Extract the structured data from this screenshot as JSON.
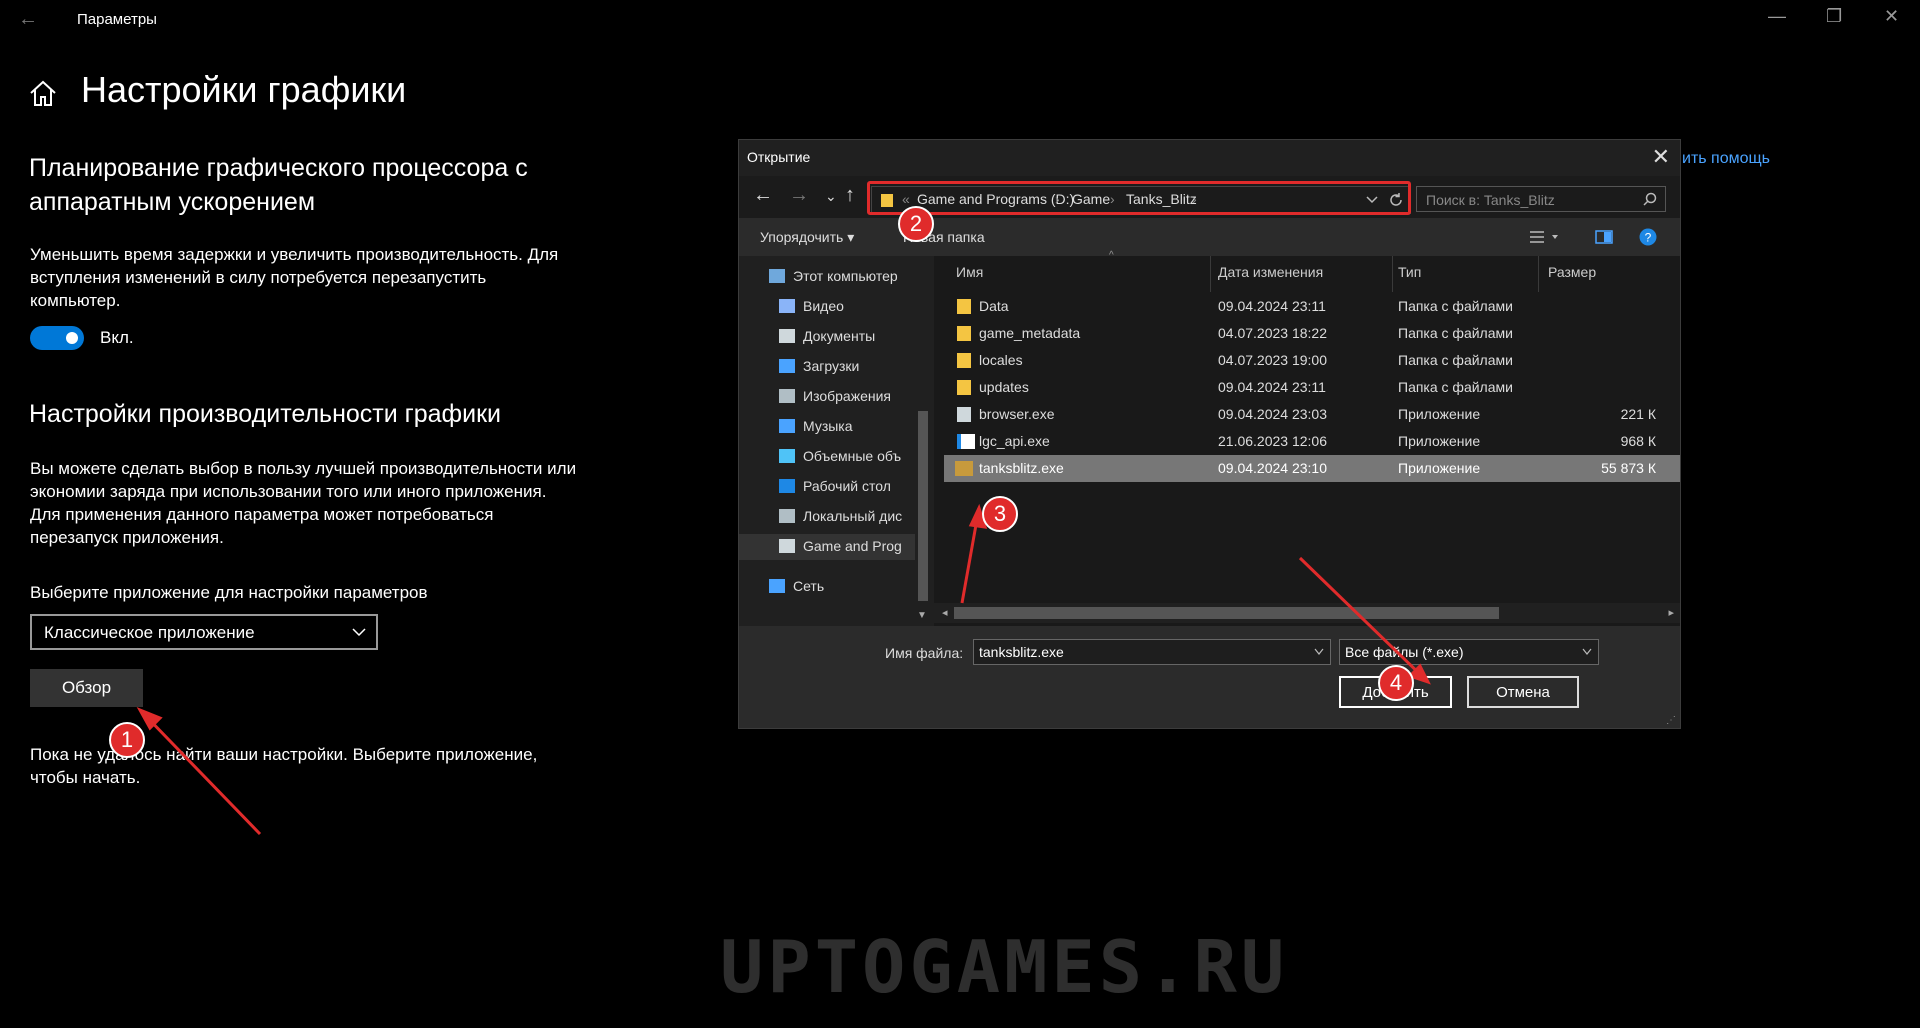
{
  "window": {
    "back_glyph": "←",
    "app_title": "Параметры",
    "controls": {
      "minimize": "—",
      "maximize": "❐",
      "close": "✕"
    }
  },
  "page": {
    "title": "Настройки графики",
    "section1": {
      "heading_line1": "Планирование графического процессора с",
      "heading_line2": "аппаратным ускорением",
      "desc_line1": "Уменьшить время задержки и увеличить производительность. Для",
      "desc_line2": "вступления изменений в силу потребуется перезапустить",
      "desc_line3": "компьютер.",
      "toggle_label": "Вкл."
    },
    "section2": {
      "heading": "Настройки производительности графики",
      "desc_line1": "Вы можете сделать выбор в пользу лучшей производительности или",
      "desc_line2": "экономии заряда при использовании того или иного приложения.",
      "desc_line3": "Для применения данного параметра может потребоваться",
      "desc_line4": "перезапуск приложения.",
      "select_label": "Выберите приложение для настройки параметров",
      "select_value": "Классическое приложение",
      "browse_label": "Обзор",
      "status_line1": "Пока не удалось найти ваши настройки. Выберите приложение,",
      "status_line2": "чтобы начать."
    },
    "help_link": "ить помощь"
  },
  "dialog": {
    "title": "Открытие",
    "close_glyph": "✕",
    "nav": {
      "back": "←",
      "forward": "→",
      "recent": "⌄",
      "up": "↑"
    },
    "address": {
      "prefix": "«",
      "crumbs": [
        "Game and Programs (D:)",
        "Game",
        "Tanks_Blitz"
      ],
      "sep": "›"
    },
    "search_placeholder": "Поиск в: Tanks_Blitz",
    "toolbar": {
      "organize": "Упорядочить ▾",
      "new_folder": "Новая папка"
    },
    "nav_items": [
      {
        "label": "Этот компьютер",
        "icon": "computer-icon",
        "color": "#6fa8dc"
      },
      {
        "label": "Видео",
        "icon": "video-icon",
        "color": "#8ab4f8"
      },
      {
        "label": "Документы",
        "icon": "documents-icon",
        "color": "#cfd8dc"
      },
      {
        "label": "Загрузки",
        "icon": "downloads-icon",
        "color": "#4aa3ff"
      },
      {
        "label": "Изображения",
        "icon": "pictures-icon",
        "color": "#b0bec5"
      },
      {
        "label": "Музыка",
        "icon": "music-icon",
        "color": "#4aa3ff"
      },
      {
        "label": "Объемные объ",
        "icon": "3d-objects-icon",
        "color": "#4fc3f7"
      },
      {
        "label": "Рабочий стол",
        "icon": "desktop-icon",
        "color": "#1e88e5"
      },
      {
        "label": "Локальный дис",
        "icon": "local-disk-icon",
        "color": "#b0bec5"
      },
      {
        "label": "Game and Prog",
        "icon": "drive-icon",
        "color": "#cfd8dc"
      },
      {
        "label": "Сеть",
        "icon": "network-icon",
        "color": "#4aa3ff"
      }
    ],
    "columns": {
      "name": "Имя",
      "date": "Дата изменения",
      "type": "Тип",
      "size": "Размер"
    },
    "files": [
      {
        "name": "Data",
        "date": "09.04.2024 23:11",
        "type": "Папка с файлами",
        "size": "",
        "icon": "folder-icon"
      },
      {
        "name": "game_metadata",
        "date": "04.07.2023 18:22",
        "type": "Папка с файлами",
        "size": "",
        "icon": "folder-icon"
      },
      {
        "name": "locales",
        "date": "04.07.2023 19:00",
        "type": "Папка с файлами",
        "size": "",
        "icon": "folder-icon"
      },
      {
        "name": "updates",
        "date": "09.04.2024 23:11",
        "type": "Папка с файлами",
        "size": "",
        "icon": "folder-icon"
      },
      {
        "name": "browser.exe",
        "date": "09.04.2024 23:03",
        "type": "Приложение",
        "size": "221 К",
        "icon": "exe-icon"
      },
      {
        "name": "lgc_api.exe",
        "date": "21.06.2023 12:06",
        "type": "Приложение",
        "size": "968 К",
        "icon": "lgc-icon"
      },
      {
        "name": "tanksblitz.exe",
        "date": "09.04.2024 23:10",
        "type": "Приложение",
        "size": "55 873 К",
        "icon": "tanksblitz-icon"
      }
    ],
    "filename_label": "Имя файла:",
    "filename_value": "tanksblitz.exe",
    "filetype_value": "Все файлы (*.exe)",
    "add_button": "Добавить",
    "cancel_button": "Отмена"
  },
  "annotations": [
    "1",
    "2",
    "3",
    "4"
  ],
  "watermark": "UPTOGAMES.RU",
  "colors": {
    "accent": "#0078d7",
    "annotation": "#e02b2b",
    "link": "#4aa3ff"
  }
}
